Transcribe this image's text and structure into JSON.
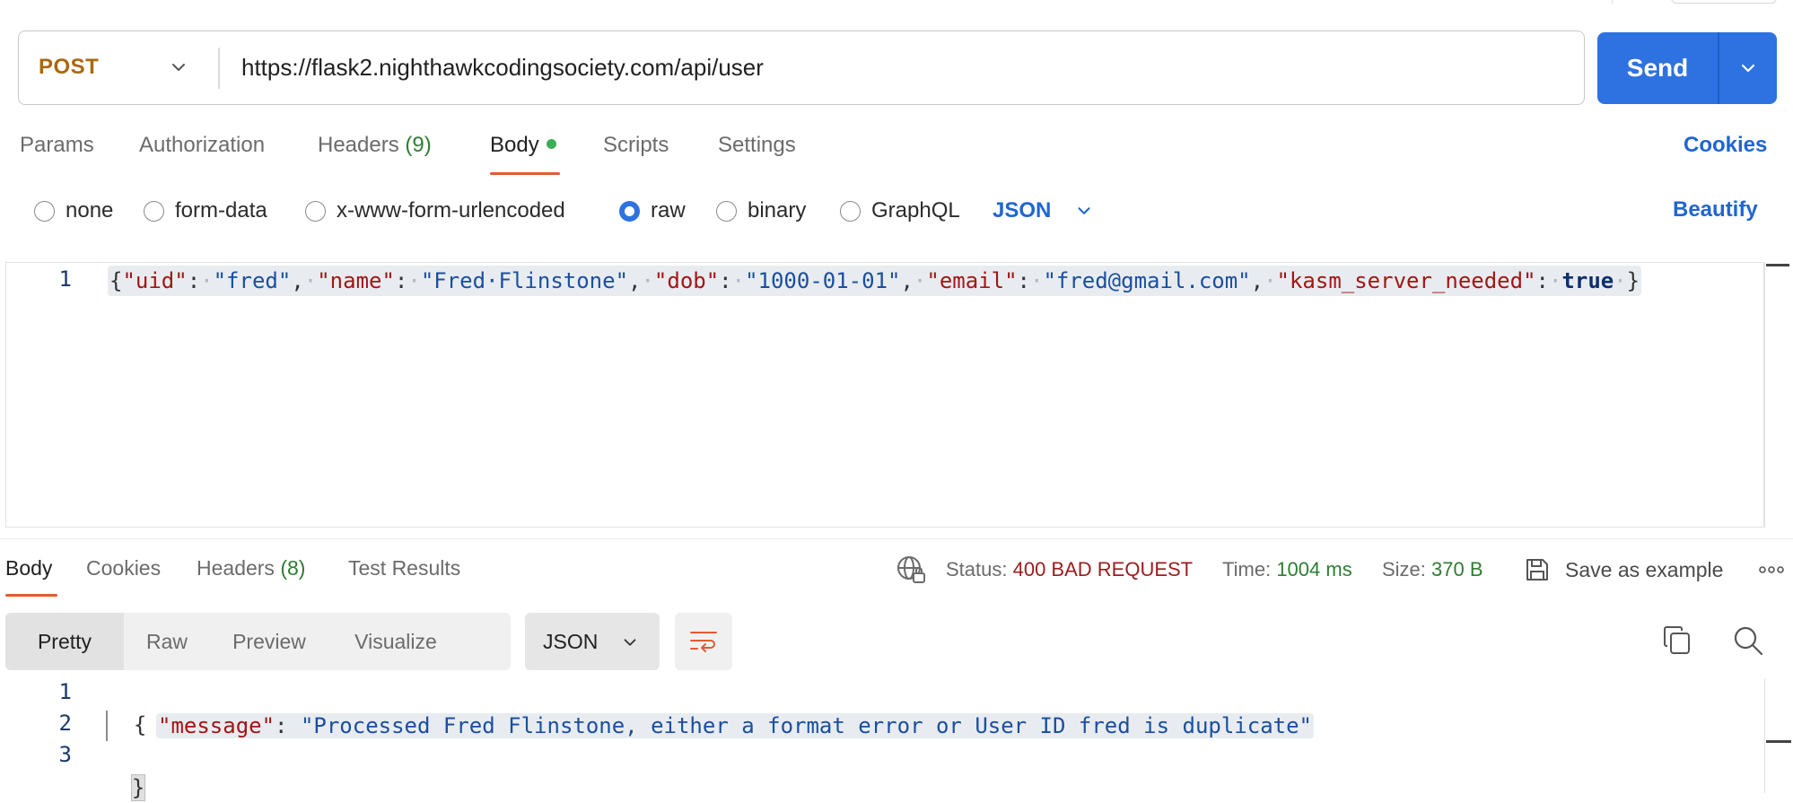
{
  "request": {
    "method": "POST",
    "url": "https://flask2.nighthawkcodingsociety.com/api/user",
    "send_label": "Send",
    "tabs": [
      {
        "label": "Params"
      },
      {
        "label": "Authorization"
      },
      {
        "label": "Headers",
        "count": "(9)"
      },
      {
        "label": "Body"
      },
      {
        "label": "Scripts"
      },
      {
        "label": "Settings"
      }
    ],
    "cookies_label": "Cookies",
    "body_types": [
      "none",
      "form-data",
      "x-www-form-urlencoded",
      "raw",
      "binary",
      "GraphQL"
    ],
    "selected_body_type": "raw",
    "language": "JSON",
    "beautify_label": "Beautify",
    "editor": {
      "line_number": "1",
      "tokens": {
        "brace_open": "{",
        "brace_close": "}",
        "k_uid": "\"uid\"",
        "v_uid": "\"fred\"",
        "k_name": "\"name\"",
        "v_name": "\"Fred·Flinstone\"",
        "k_dob": "\"dob\"",
        "v_dob": "\"1000-01-01\"",
        "k_email": "\"email\"",
        "v_email": "\"fred@gmail.com\"",
        "k_kasm": "\"kasm_server_needed\"",
        "v_kasm": "true"
      }
    }
  },
  "response": {
    "tabs": [
      {
        "label": "Body"
      },
      {
        "label": "Cookies"
      },
      {
        "label": "Headers",
        "count": "(8)"
      },
      {
        "label": "Test Results"
      }
    ],
    "status_label": "Status:",
    "status_value": "400 BAD REQUEST",
    "time_label": "Time:",
    "time_value": "1004 ms",
    "size_label": "Size:",
    "size_value": "370 B",
    "save_example_label": "Save as example",
    "views": [
      "Pretty",
      "Raw",
      "Preview",
      "Visualize"
    ],
    "active_view": "Pretty",
    "format": "JSON",
    "editor": {
      "line_numbers": [
        "1",
        "2",
        "3"
      ],
      "open_brace": "{",
      "key": "\"message\"",
      "colon": ": ",
      "value": "\"Processed Fred Flinstone, either a format error or User ID fred is duplicate\"",
      "close_brace": "}"
    }
  },
  "colors": {
    "accent_orange": "#e25a33",
    "send_blue": "#2d72e0",
    "link_blue": "#1f66d1",
    "method_post": "#a8690f",
    "status_error": "#9b1c1c",
    "status_ok_green": "#2e7d32"
  },
  "icons": {
    "method_dropdown": "chevron-down-icon",
    "send_dropdown": "chevron-down-icon",
    "network": "globe-lock-icon",
    "save": "floppy-disk-icon",
    "more": "more-horizontal-icon",
    "wrap": "wrap-lines-icon",
    "copy": "copy-icon",
    "search": "search-icon"
  }
}
